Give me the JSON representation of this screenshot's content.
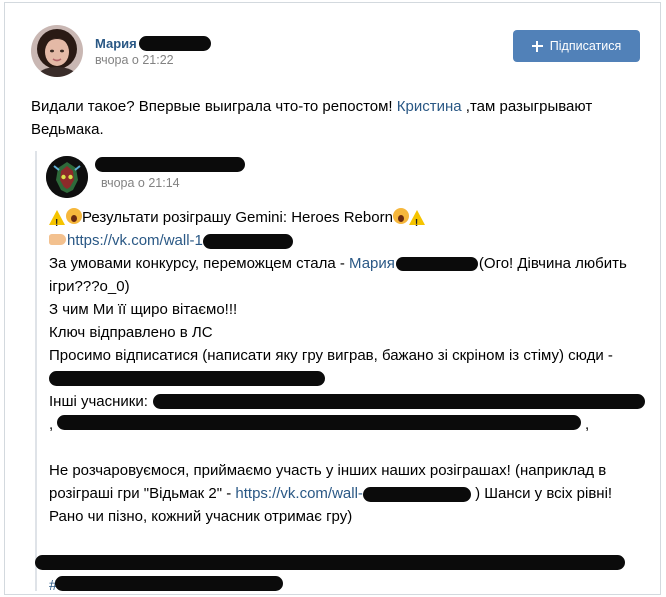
{
  "post": {
    "author_name": "Мария",
    "time": "вчора о 21:22",
    "subscribe_label": "Підписатися",
    "text_part1": "Видали такое? Впервые выиграла что-то репостом! ",
    "mention": "Кристина",
    "text_part2": " ,там разыгрывают Ведьмака."
  },
  "repost": {
    "time": "вчора о 21:14",
    "title": "Результати розіграшу Gemini: Heroes Reborn",
    "link1": "https://vk.com/wall-1",
    "line3_prefix": "За умовами конкурсу, переможцем стала - ",
    "winner_name": "Мария",
    "line3_suffix": "(Ого! Дівчина любить",
    "line4": "ігри???o_0)",
    "line5": "З чим Ми її щиро вітаємо!!!",
    "line6": "Ключ відправлено в ЛС",
    "line7": "Просимо відписатися (написати яку гру виграв, бажано зі скріном із стіму) сюди -",
    "line9_prefix": "Інші учасники: ",
    "line10_start": ",",
    "line10_end": ",",
    "line12": "Не розчаровуємося, приймаємо участь у інших наших розіграшах! (наприклад в",
    "line13_prefix": "розіграші гри \"Відьмак 2\" - ",
    "link2": "https://vk.com/wall-",
    "line13_suffix": " ) Шанси у всіх рівні!",
    "line14": "Рано чи пізно, кожний учасник отримає гру)",
    "hashtag_start": "#"
  },
  "colors": {
    "link": "#2a5885",
    "button": "#5181b8",
    "meta": "#828282",
    "border": "#d3d9de"
  }
}
